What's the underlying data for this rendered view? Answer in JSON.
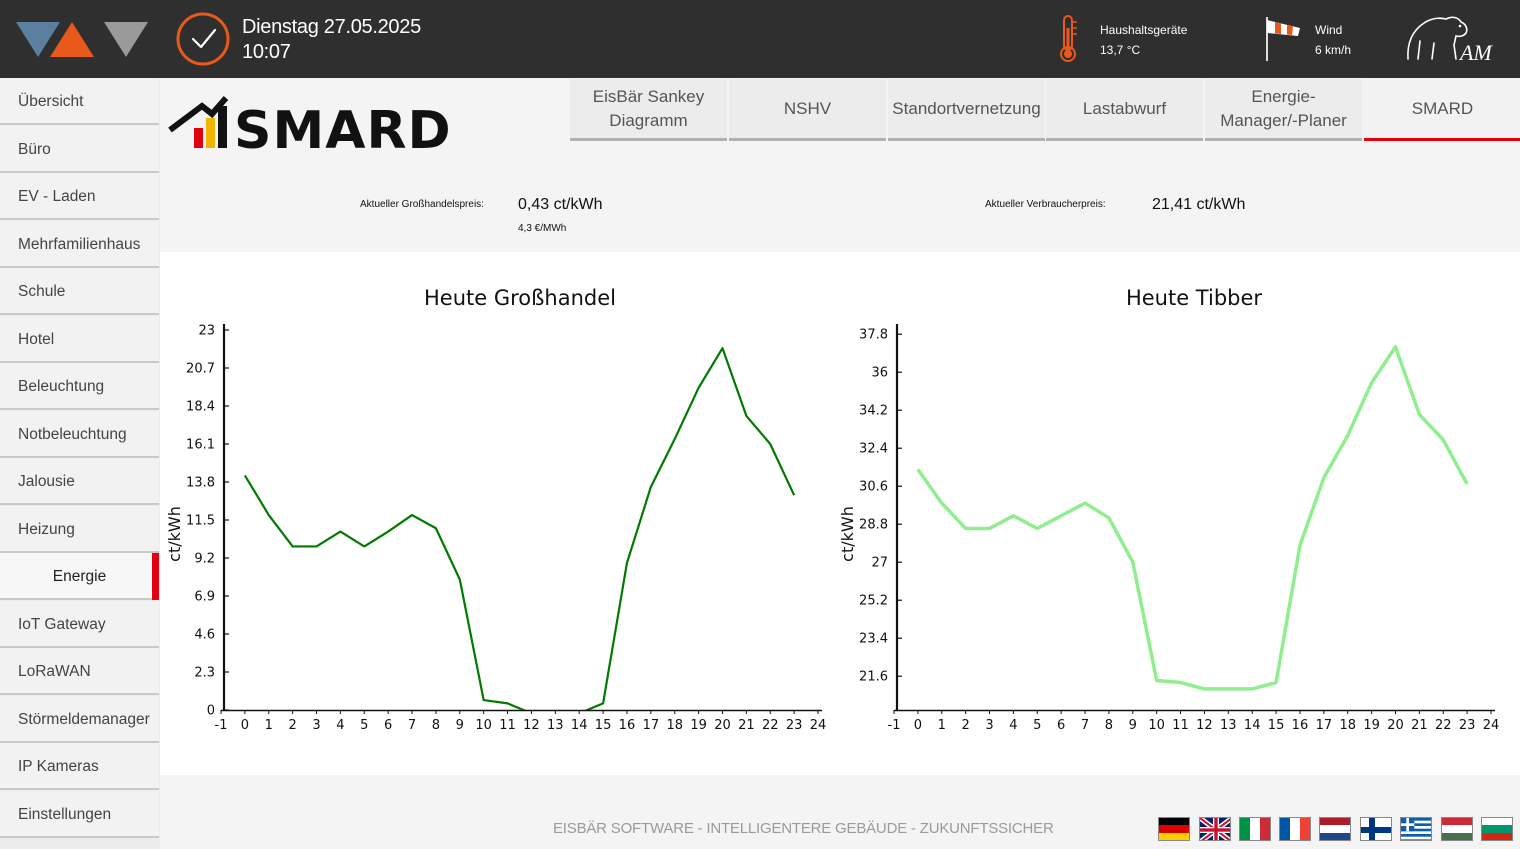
{
  "header": {
    "date": "Dienstag 27.05.2025",
    "time": "10:07",
    "sensor_label": "Haushaltsgeräte",
    "sensor_value": "13,7 °C",
    "wind_label": "Wind",
    "wind_value": "6 km/h",
    "brand_initials": "AM"
  },
  "sidebar": {
    "items": [
      {
        "label": "Übersicht"
      },
      {
        "label": "Büro"
      },
      {
        "label": "EV - Laden"
      },
      {
        "label": "Mehrfamilienhaus"
      },
      {
        "label": "Schule"
      },
      {
        "label": "Hotel"
      },
      {
        "label": "Beleuchtung"
      },
      {
        "label": "Notbeleuchtung"
      },
      {
        "label": "Jalousie"
      },
      {
        "label": "Heizung"
      },
      {
        "label": "Energie"
      },
      {
        "label": "IoT Gateway"
      },
      {
        "label": "LoRaWAN"
      },
      {
        "label": "Störmeldemanager"
      },
      {
        "label": "IP Kameras"
      },
      {
        "label": "Einstellungen"
      }
    ],
    "active_index": 10
  },
  "logo_text": "SMARD",
  "tabs": [
    {
      "label": "EisBär Sankey Diagramm"
    },
    {
      "label": "NSHV"
    },
    {
      "label": "Standortvernetzung"
    },
    {
      "label": "Lastabwurf"
    },
    {
      "label": "Energie-Manager/-Planer"
    },
    {
      "label": "SMARD"
    }
  ],
  "active_tab": 5,
  "prices": {
    "wholesale_label": "Aktueller Großhandelspreis:",
    "wholesale_value": "0,43 ct/kWh",
    "wholesale_sub": "4,3 €/MWh",
    "consumer_label": "Aktueller Verbraucherpreis:",
    "consumer_value": "21,41 ct/kWh"
  },
  "chart_data": [
    {
      "type": "line",
      "title": "Heute Großhandel",
      "ylabel": "ct/kWh",
      "xlabel": "",
      "color": "#007a00",
      "xlim": [
        -1,
        24
      ],
      "ylim": [
        0,
        23
      ],
      "yticks": [
        "0",
        "2.3",
        "4.6",
        "6.9",
        "9.2",
        "11.5",
        "13.8",
        "16.1",
        "18.4",
        "20.7",
        "23"
      ],
      "xticks": [
        -1,
        0,
        1,
        2,
        3,
        4,
        5,
        6,
        7,
        8,
        9,
        10,
        11,
        12,
        13,
        14,
        15,
        16,
        17,
        18,
        19,
        20,
        21,
        22,
        23,
        24
      ],
      "x": [
        0,
        1,
        2,
        3,
        4,
        5,
        6,
        7,
        8,
        9,
        10,
        11,
        12,
        13,
        14,
        15,
        16,
        17,
        18,
        19,
        20,
        21,
        22,
        23
      ],
      "values": [
        14.2,
        11.8,
        9.9,
        9.9,
        10.8,
        9.9,
        10.8,
        11.8,
        11.0,
        7.9,
        0.6,
        0.4,
        -0.2,
        -0.5,
        -0.2,
        0.4,
        8.9,
        13.5,
        16.4,
        19.5,
        21.9,
        17.8,
        16.1,
        13.0
      ]
    },
    {
      "type": "line",
      "title": "Heute Tibber",
      "ylabel": "ct/kWh",
      "xlabel": "",
      "color": "#90ee90",
      "xlim": [
        -1,
        24
      ],
      "ylim": [
        20,
        38
      ],
      "yticks": [
        "21.6",
        "23.4",
        "25.2",
        "27",
        "28.8",
        "30.6",
        "32.4",
        "34.2",
        "36",
        "37.8"
      ],
      "ytick_values": [
        21.6,
        23.4,
        25.2,
        27,
        28.8,
        30.6,
        32.4,
        34.2,
        36,
        37.8
      ],
      "xticks": [
        -1,
        0,
        1,
        2,
        3,
        4,
        5,
        6,
        7,
        8,
        9,
        10,
        11,
        12,
        13,
        14,
        15,
        16,
        17,
        18,
        19,
        20,
        21,
        22,
        23,
        24
      ],
      "x": [
        0,
        1,
        2,
        3,
        4,
        5,
        6,
        7,
        8,
        9,
        10,
        11,
        12,
        13,
        14,
        15,
        16,
        17,
        18,
        19,
        20,
        21,
        22,
        23
      ],
      "values": [
        31.4,
        29.8,
        28.6,
        28.6,
        29.2,
        28.6,
        29.2,
        29.8,
        29.1,
        27.0,
        21.4,
        21.3,
        21.0,
        21.0,
        21.0,
        21.3,
        27.8,
        31.0,
        33.0,
        35.5,
        37.2,
        34.0,
        32.8,
        30.7
      ]
    }
  ],
  "footer": {
    "text": "EISBÄR SOFTWARE - INTELLIGENTERE GEBÄUDE - ZUKUNFTSSICHER",
    "flags": [
      "de",
      "gb",
      "it",
      "fr",
      "nl",
      "fi",
      "gr",
      "hu",
      "bg"
    ]
  }
}
